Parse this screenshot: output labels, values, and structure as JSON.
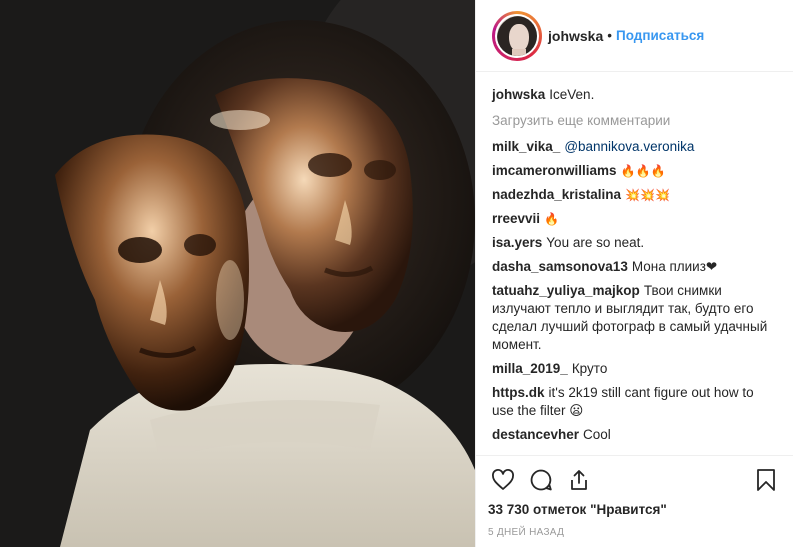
{
  "header": {
    "username": "johwska",
    "separator": "•",
    "follow_label": "Подписаться"
  },
  "caption": {
    "user": "johwska",
    "text": "IceVen."
  },
  "load_more_label": "Загрузить еще комментарии",
  "comments": [
    {
      "user": "milk_vika_",
      "text": "@bannikova.veronika",
      "mention": true
    },
    {
      "user": "imcameronwilliams",
      "text": "🔥🔥🔥"
    },
    {
      "user": "nadezhda_kristalina",
      "text": "💥💥💥"
    },
    {
      "user": "rreevvii",
      "text": "🔥"
    },
    {
      "user": "isa.yers",
      "text": "You are so neat."
    },
    {
      "user": "dasha_samsonova13",
      "text": "Мона плииз❤"
    },
    {
      "user": "tatuahz_yuliya_majkop",
      "text": "Твои снимки излучают тепло и выглядит так, будто его сделал лучший фотограф в самый удачный момент."
    },
    {
      "user": "milla_2019_",
      "text": "Круто"
    },
    {
      "user": "https.dk",
      "text": "it's 2k19 still cant figure out how to use the filter 😦"
    },
    {
      "user": "destancevher",
      "text": "Cool"
    }
  ],
  "icons": {
    "like": "heart-icon",
    "comment": "comment-bubble-icon",
    "share": "share-icon",
    "save": "bookmark-icon"
  },
  "likes_text": "33 730 отметок \"Нравится\"",
  "timestamp": "5 дней назад",
  "colors": {
    "link": "#3897f0",
    "muted": "#999999",
    "mention": "#003569"
  }
}
